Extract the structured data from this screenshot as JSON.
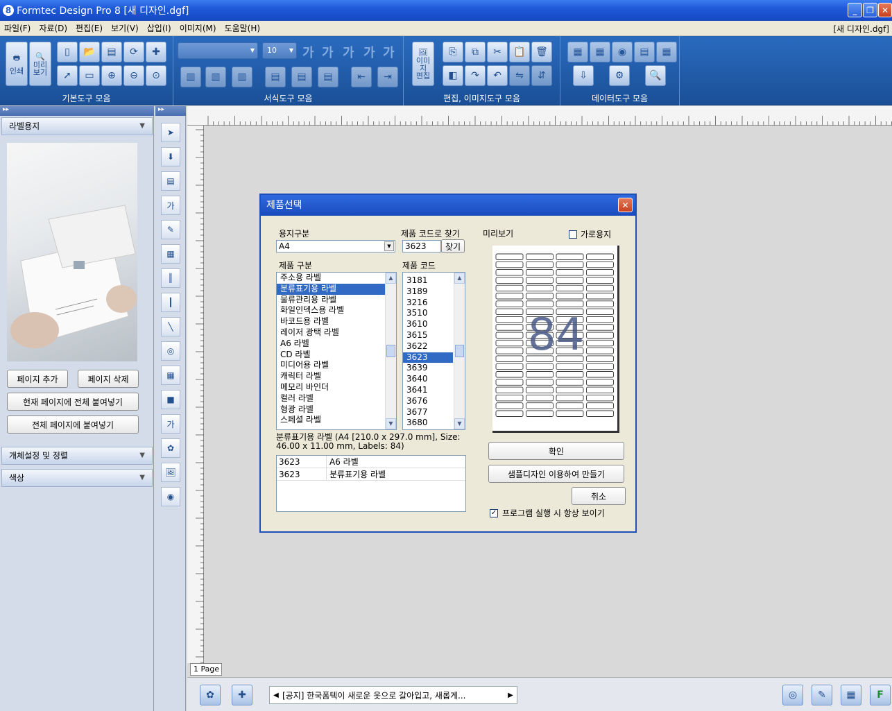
{
  "window": {
    "title": "Formtec Design Pro 8 [새 디자인.dgf]",
    "doc_name": "[새 디자인.dgf]"
  },
  "menu": [
    "파일(F)",
    "자료(D)",
    "편집(E)",
    "보기(V)",
    "삽입(I)",
    "이미지(M)",
    "도움말(H)"
  ],
  "ribbon": {
    "groups": [
      "기본도구 모음",
      "서식도구 모음",
      "편집, 이미지도구 모음",
      "데이터도구 모음"
    ],
    "print_label": "인쇄",
    "preview_label": "미리\n보기",
    "font_size": "10",
    "image_edit_label": "이미지\n편집",
    "format_glyph": "가"
  },
  "left_panel": {
    "header": "라벨용지",
    "add_page": "페이지 추가",
    "delete_page": "페이지 삭제",
    "paste_current": "현재 페이지에 전체 붙여넣기",
    "paste_all": "전체 페이지에 붙여넣기",
    "object_settings": "개체설정 및 정렬",
    "color": "색상"
  },
  "canvas": {
    "page_tab": "1 Page"
  },
  "ticker": "[공지] 한국폼텍이 새로운 옷으로 갈아입고, 새롭게...",
  "dialog": {
    "title": "제품선택",
    "paper_label": "용지구분",
    "paper_value": "A4",
    "code_find_label": "제품 코드로 찾기",
    "code_value": "3623",
    "find_button": "찾기",
    "preview_label": "미리보기",
    "landscape_label": "가로용지",
    "category_label": "제품 구분",
    "code_label": "제품 코드",
    "categories": [
      "주소용 라벨",
      "분류표기용 라벨",
      "물류관리용 라벨",
      "화일인덱스용 라벨",
      "바코드용 라벨",
      "레이저 광택 라벨",
      "A6 라벨",
      "CD 라벨",
      "미디어용 라벨",
      "캐릭터 라벨",
      "메모리 바인더",
      "컬러 라벨",
      "형광 라벨",
      "스페셜 라벨"
    ],
    "selected_category": "분류표기용 라벨",
    "codes": [
      "3181",
      "3189",
      "3216",
      "3510",
      "3610",
      "3615",
      "3622",
      "3623",
      "3639",
      "3640",
      "3641",
      "3676",
      "3677",
      "3680"
    ],
    "selected_code": "3623",
    "description_line1": "분류표기용 라벨 (A4 [210.0 x 297.0 mm], Size:",
    "description_line2": "46.00 x 11.00 mm, Labels: 84)",
    "results": [
      {
        "code": "3623",
        "name": "A6 라벨"
      },
      {
        "code": "3623",
        "name": "분류표기용 라벨"
      }
    ],
    "preview_count": "84",
    "ok": "확인",
    "sample": "샘플디자인 이용하여 만들기",
    "cancel": "취소",
    "always_show": "프로그램 실행 시 항상 보이기"
  }
}
